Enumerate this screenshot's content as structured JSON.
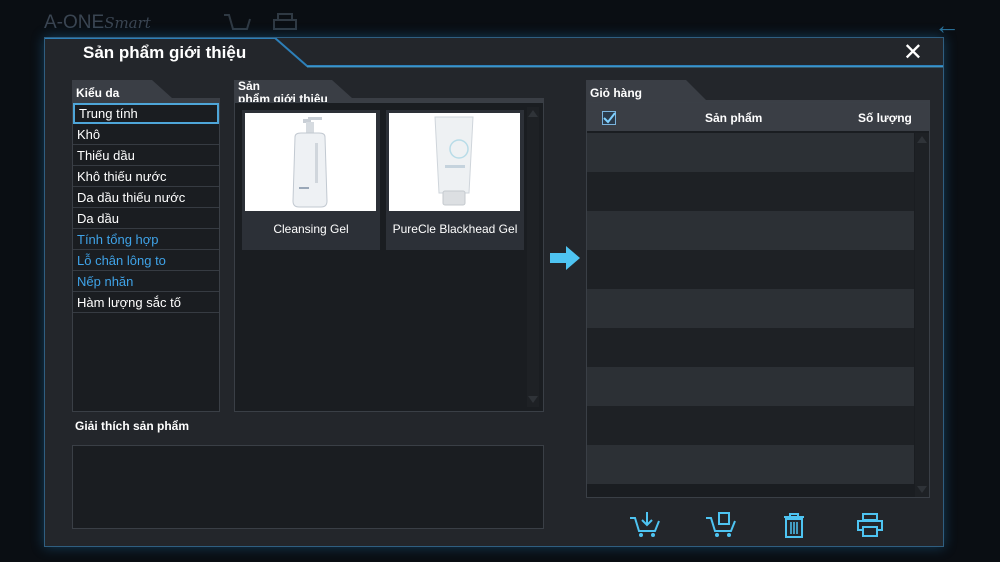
{
  "app": {
    "logo_main": "A-ONE",
    "logo_script": "Smart"
  },
  "dialog": {
    "title": "Sản phẩm giới thiệu",
    "close_label": "✕"
  },
  "skin_types": {
    "tab_label": "Kiểu da",
    "items": [
      {
        "label": "Trung tính",
        "color": "#ffffff"
      },
      {
        "label": "Khô",
        "color": "#ffffff"
      },
      {
        "label": "Thiếu dầu",
        "color": "#ffffff"
      },
      {
        "label": "Khô thiếu nước",
        "color": "#ffffff"
      },
      {
        "label": "Da dầu thiếu nước",
        "color": "#ffffff"
      },
      {
        "label": "Da dầu",
        "color": "#ffffff"
      },
      {
        "label": "Tính tổng hợp",
        "color": "#3fa3e8"
      },
      {
        "label": "Lỗ chân lông to",
        "color": "#3fa3e8"
      },
      {
        "label": "Nếp nhăn",
        "color": "#3fa3e8"
      },
      {
        "label": "Hàm lượng sắc tố",
        "color": "#ffffff"
      }
    ],
    "selected": "Trung tính"
  },
  "products": {
    "tab_label_line1": "Sản",
    "tab_label_line2": "phẩm giới thiệu",
    "items": [
      {
        "name": "Cleansing Gel",
        "image": "pump-bottle-icon"
      },
      {
        "name": "PureCle Blackhead Gel",
        "image": "tube-icon"
      }
    ]
  },
  "description": {
    "label": "Giải thích sản phẩm",
    "text": ""
  },
  "cart": {
    "tab_label": "Giỏ hàng",
    "header_product": "Sản phẩm",
    "header_quantity": "Số lượng",
    "select_all_checked": true,
    "rows": []
  },
  "toolbar": {
    "icons": [
      "cart-add-icon",
      "cart-edit-icon",
      "trash-icon",
      "print-icon"
    ]
  },
  "colors": {
    "accent": "#4ec4f2",
    "panel_border": "#2f5e80",
    "dialog_bg": "#23262b"
  }
}
